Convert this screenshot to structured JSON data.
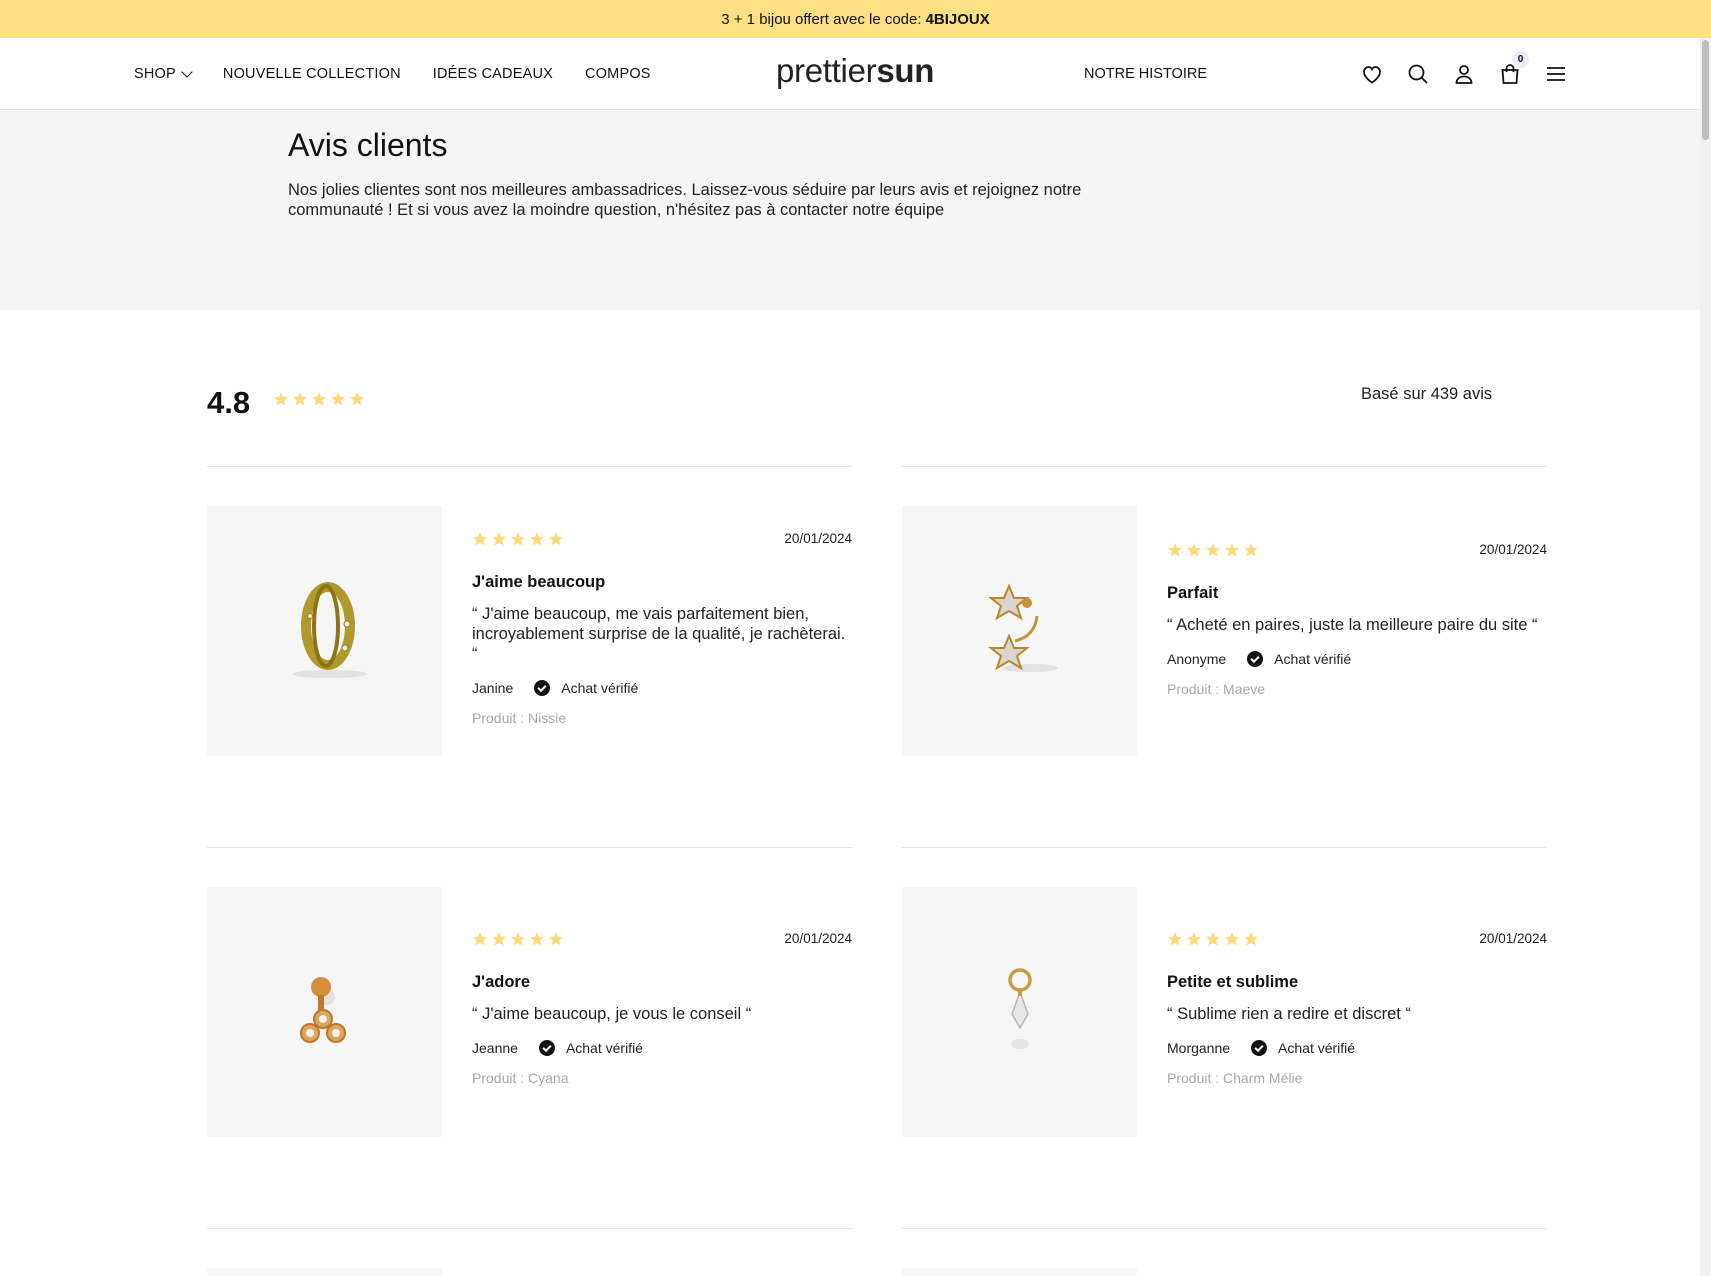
{
  "announcement": {
    "text": "3 + 1 bijou offert avec le code:",
    "code": "4BIJOUX"
  },
  "nav": {
    "shop": "SHOP",
    "new_collection": "NOUVELLE COLLECTION",
    "gift_ideas": "IDÉES CADEAUX",
    "compos": "COMPOS",
    "our_story": "NOTRE HISTOIRE"
  },
  "logo": {
    "light": "prettier",
    "bold": "sun"
  },
  "cart": {
    "count": "0"
  },
  "hero": {
    "title": "Avis clients",
    "description": "Nos jolies clientes sont nos meilleures ambassadrices. Laissez-vous séduire par leurs avis et rejoignez notre communauté ! Et si vous avez la moindre question, n'hésitez pas à contacter notre équipe"
  },
  "summary": {
    "score": "4.8",
    "stars": 5,
    "count_text": "Basé sur 439 avis"
  },
  "colors": {
    "accent": "#fde083",
    "star": "#fcd97a",
    "hero_bg": "#f5f5f5"
  },
  "reviews": [
    {
      "stars": 5,
      "date": "20/01/2024",
      "title": "J'aime beaucoup",
      "body": "“ J'aime beaucoup, me vais parfaitement bien, incroyablement surprise de la qualité, je rachèterai. “",
      "author": "Janine",
      "verified": "Achat vérifié",
      "product": "Produit : Nissie",
      "image_icon": "hoop-earring-icon"
    },
    {
      "stars": 5,
      "date": "20/01/2024",
      "title": "Parfait",
      "body": "“ Acheté en paires, juste la meilleure paire du site “",
      "author": "Anonyme",
      "verified": "Achat vérifié",
      "product": "Produit : Maeve",
      "image_icon": "star-earring-icon"
    },
    {
      "stars": 5,
      "date": "20/01/2024",
      "title": "J'adore",
      "body": "“ J'aime beaucoup, je vous le conseil “",
      "author": "Jeanne",
      "verified": "Achat vérifié",
      "product": "Produit : Cyana",
      "image_icon": "stud-earring-icon"
    },
    {
      "stars": 5,
      "date": "20/01/2024",
      "title": "Petite et sublime",
      "body": "“ Sublime rien a redire et discret “",
      "author": "Morganne",
      "verified": "Achat vérifié",
      "product": "Produit : Charm Mélie",
      "image_icon": "charm-pendant-icon"
    }
  ]
}
